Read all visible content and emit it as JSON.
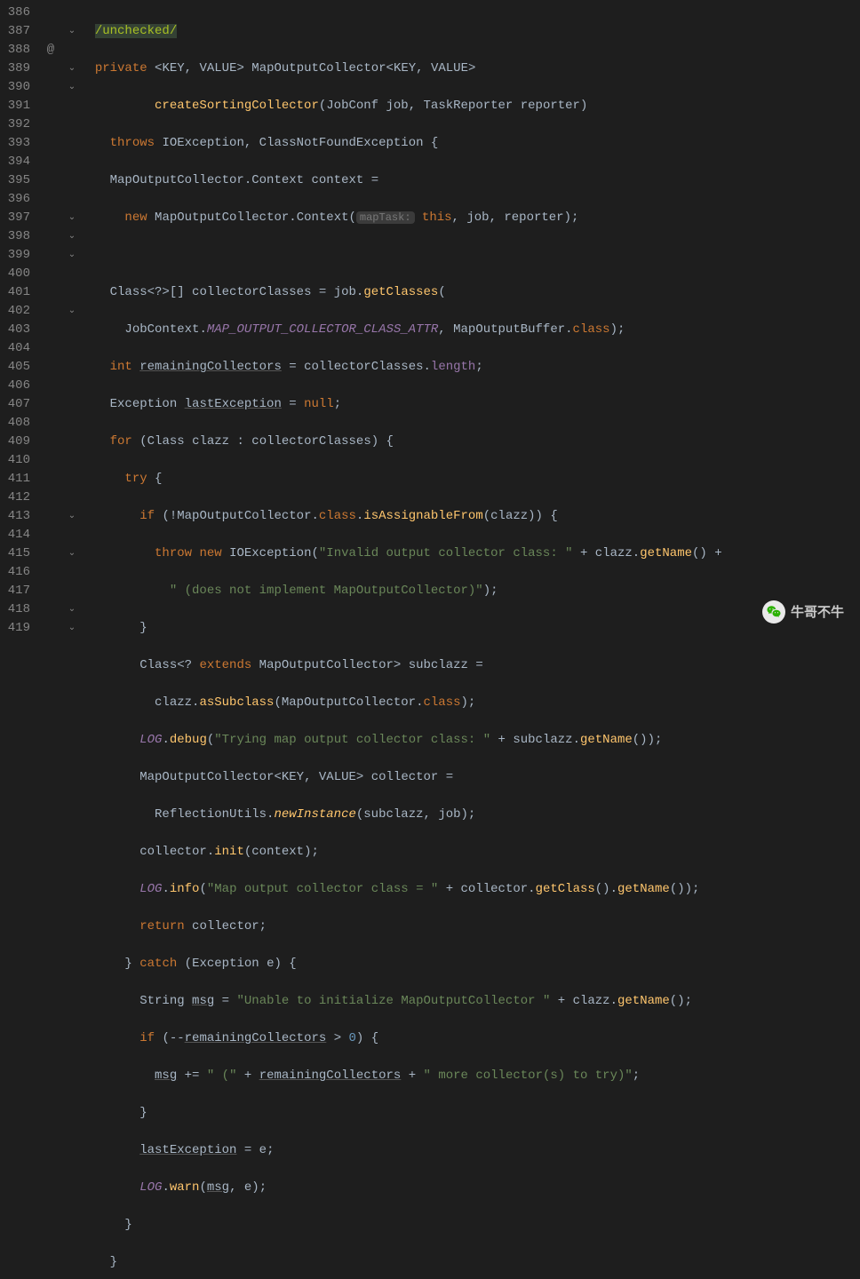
{
  "lines": [
    {
      "num": "386",
      "ann": ""
    },
    {
      "num": "387",
      "ann": ""
    },
    {
      "num": "388",
      "ann": "@"
    },
    {
      "num": "389",
      "ann": ""
    },
    {
      "num": "390",
      "ann": ""
    },
    {
      "num": "391",
      "ann": ""
    },
    {
      "num": "392",
      "ann": ""
    },
    {
      "num": "393",
      "ann": ""
    },
    {
      "num": "394",
      "ann": ""
    },
    {
      "num": "395",
      "ann": ""
    },
    {
      "num": "396",
      "ann": ""
    },
    {
      "num": "397",
      "ann": ""
    },
    {
      "num": "398",
      "ann": ""
    },
    {
      "num": "399",
      "ann": ""
    },
    {
      "num": "400",
      "ann": ""
    },
    {
      "num": "401",
      "ann": ""
    },
    {
      "num": "402",
      "ann": ""
    },
    {
      "num": "403",
      "ann": ""
    },
    {
      "num": "404",
      "ann": ""
    },
    {
      "num": "405",
      "ann": ""
    },
    {
      "num": "406",
      "ann": ""
    },
    {
      "num": "407",
      "ann": ""
    },
    {
      "num": "408",
      "ann": ""
    },
    {
      "num": "409",
      "ann": ""
    },
    {
      "num": "410",
      "ann": ""
    },
    {
      "num": "411",
      "ann": ""
    },
    {
      "num": "412",
      "ann": ""
    },
    {
      "num": "413",
      "ann": ""
    },
    {
      "num": "414",
      "ann": ""
    },
    {
      "num": "415",
      "ann": ""
    },
    {
      "num": "416",
      "ann": ""
    },
    {
      "num": "417",
      "ann": ""
    },
    {
      "num": "418",
      "ann": ""
    },
    {
      "num": "419",
      "ann": ""
    }
  ],
  "code": {
    "l386_todo": "/unchecked/",
    "l387_private": "private",
    "l387_key": "KEY",
    "l387_value": "VALUE",
    "l387_moc": "MapOutputCollector",
    "l388_method": "createSortingCollector",
    "l388_jobconf": "JobConf",
    "l388_job": "job",
    "l388_tr": "TaskReporter",
    "l388_reporter": "reporter",
    "l389_throws": "throws",
    "l389_ioe": "IOException",
    "l389_cnfe": "ClassNotFoundException",
    "l390_moc": "MapOutputCollector",
    "l390_ctx": "Context",
    "l390_var": "context",
    "l391_new": "new",
    "l391_moc": "MapOutputCollector",
    "l391_ctx": "Context",
    "l391_hint": "mapTask:",
    "l391_this": "this",
    "l391_job": "job",
    "l391_reporter": "reporter",
    "l393_class": "Class",
    "l393_var": "collectorClasses",
    "l393_job": "job",
    "l393_m": "getClasses",
    "l394_jc": "JobContext",
    "l394_const": "MAP_OUTPUT_COLLECTOR_CLASS_ATTR",
    "l394_mob": "MapOutputBuffer",
    "l394_cls": "class",
    "l395_int": "int",
    "l395_var": "remainingCollectors",
    "l395_cc": "collectorClasses",
    "l395_len": "length",
    "l396_exc": "Exception",
    "l396_var": "lastException",
    "l396_null": "null",
    "l397_for": "for",
    "l397_class": "Class",
    "l397_clazz": "clazz",
    "l397_cc": "collectorClasses",
    "l398_try": "try",
    "l399_if": "if",
    "l399_moc": "MapOutputCollector",
    "l399_cls": "class",
    "l399_m": "isAssignableFrom",
    "l399_clazz": "clazz",
    "l400_throw": "throw",
    "l400_new": "new",
    "l400_ioe": "IOException",
    "l400_str": "\"Invalid output collector class: \"",
    "l400_clazz": "clazz",
    "l400_gn": "getName",
    "l401_str": "\" (does not implement MapOutputCollector)\"",
    "l403_class": "Class",
    "l403_ext": "extends",
    "l403_moc": "MapOutputCollector",
    "l403_var": "subclazz",
    "l404_clazz": "clazz",
    "l404_m": "asSubclass",
    "l404_moc": "MapOutputCollector",
    "l404_cls": "class",
    "l405_log": "LOG",
    "l405_m": "debug",
    "l405_str": "\"Trying map output collector class: \"",
    "l405_sub": "subclazz",
    "l405_gn": "getName",
    "l406_moc": "MapOutputCollector",
    "l406_key": "KEY",
    "l406_value": "VALUE",
    "l406_var": "collector",
    "l407_ru": "ReflectionUtils",
    "l407_m": "newInstance",
    "l407_sub": "subclazz",
    "l407_job": "job",
    "l408_col": "collector",
    "l408_m": "init",
    "l408_ctx": "context",
    "l409_log": "LOG",
    "l409_m": "info",
    "l409_str": "\"Map output collector class = \"",
    "l409_col": "collector",
    "l409_gc": "getClass",
    "l409_gn": "getName",
    "l410_ret": "return",
    "l410_col": "collector",
    "l411_catch": "catch",
    "l411_exc": "Exception",
    "l411_e": "e",
    "l412_str_t": "String",
    "l412_msg": "msg",
    "l412_str": "\"Unable to initialize MapOutputCollector \"",
    "l412_clazz": "clazz",
    "l412_gn": "getName",
    "l413_if": "if",
    "l413_rc": "remainingCollectors",
    "l413_zero": "0",
    "l414_msg": "msg",
    "l414_str1": "\" (\"",
    "l414_rc": "remainingCollectors",
    "l414_str2": "\" more collector(s) to try)\"",
    "l416_le": "lastException",
    "l416_e": "e",
    "l417_log": "LOG",
    "l417_m": "warn",
    "l417_msg": "msg",
    "l417_e": "e"
  },
  "watermark": {
    "text": "牛哥不牛"
  }
}
